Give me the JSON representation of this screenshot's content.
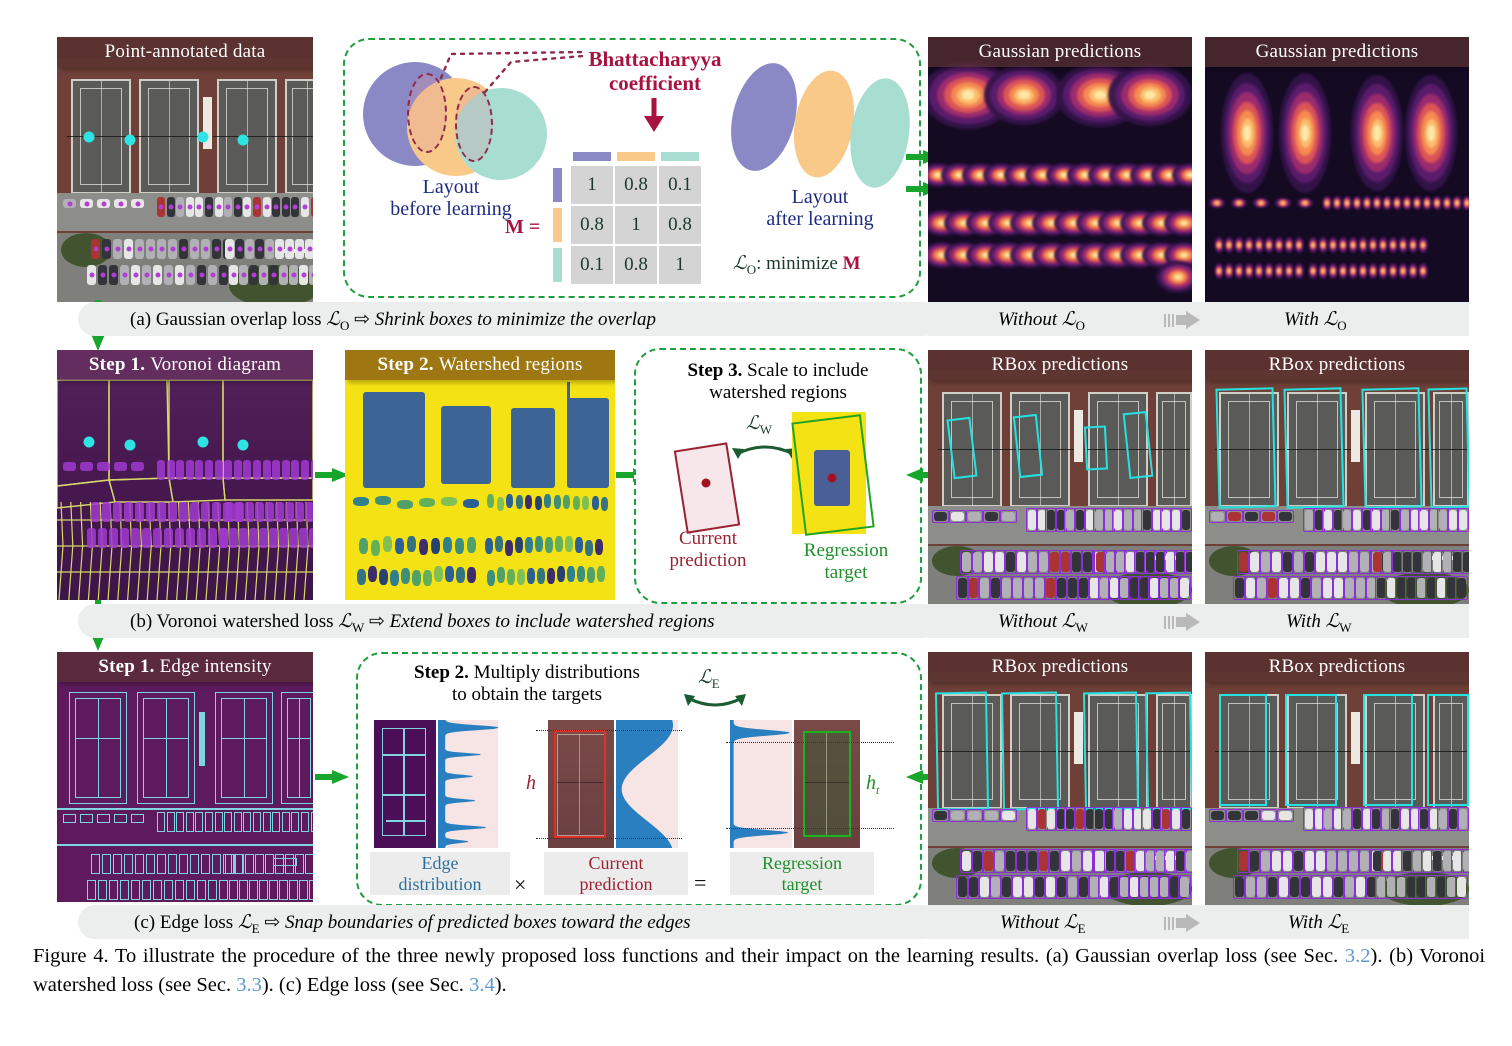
{
  "figure": {
    "caption_prefix": "Figure 4.",
    "caption_body": " To illustrate the procedure of the three newly proposed loss functions and their impact on the learning results. (a) Gaussian overlap loss (see Sec. ",
    "sec_a": "3.2",
    "caption_mid1": "). (b) Voronoi watershed loss (see Sec. ",
    "sec_b": "3.3",
    "caption_mid2": "). (c) Edge loss (see Sec. ",
    "sec_c": "3.4",
    "caption_end": ")."
  },
  "row_a": {
    "input_panel": {
      "title": "Point-annotated data"
    },
    "diagram": {
      "bhattacharyya_title": "Bhattacharyya\ncoefficient",
      "bhattacharyya_line1": "Bhattacharyya",
      "bhattacharyya_line2": "coefficient",
      "layout_before_line1": "Layout",
      "layout_before_line2": "before learning",
      "layout_after_line1": "Layout",
      "layout_after_line2": "after learning",
      "matrix_equals": "M =",
      "matrix_values": [
        [
          "1",
          "0.8",
          "0.1"
        ],
        [
          "0.8",
          "1",
          "0.8"
        ],
        [
          "0.1",
          "0.8",
          "1"
        ]
      ],
      "objective": "ℒO: minimize ",
      "objective_symbol": "ℒ",
      "objective_sub": "O",
      "objective_text": ": minimize ",
      "objective_bold": "M",
      "colors": {
        "purple": "#8b88c6",
        "orange": "#f9c98a",
        "teal": "#a8ddd1",
        "accent": "#a8123f",
        "navy": "#1d2b80"
      }
    },
    "result_left": {
      "title": "Gaussian predictions",
      "label": "Without ℒO",
      "label_word": "Without",
      "label_sym": "ℒ",
      "label_sub": "O"
    },
    "result_right": {
      "title": "Gaussian predictions",
      "label": "With ℒO",
      "label_word": "With",
      "label_sym": "ℒ",
      "label_sub": "O"
    },
    "caption": "(a) Gaussian overlap loss ℒO ⇨ Shrink boxes to minimize the overlap",
    "caption_plain": "(a) Gaussian overlap loss ",
    "caption_sym": "ℒ",
    "caption_sub": "O",
    "caption_arrow": " ⇨ ",
    "caption_italic": "Shrink boxes to minimize the overlap"
  },
  "row_b": {
    "step1": {
      "step": "Step 1.",
      "title": "Voronoi diagram"
    },
    "step2": {
      "step": "Step 2.",
      "title": "Watershed regions"
    },
    "step3": {
      "step": "Step 3.",
      "title_line1": "Scale to include",
      "title_line2": "watershed regions",
      "loss_sym": "ℒ",
      "loss_sub": "W",
      "current_line1": "Current",
      "current_line2": "prediction",
      "target_line1": "Regression",
      "target_line2": "target"
    },
    "result_left": {
      "title": "RBox predictions",
      "label_word": "Without",
      "label_sym": "ℒ",
      "label_sub": "W"
    },
    "result_right": {
      "title": "RBox predictions",
      "label_word": "With",
      "label_sym": "ℒ",
      "label_sub": "W"
    },
    "caption_plain": "(b) Voronoi watershed loss ",
    "caption_sym": "ℒ",
    "caption_sub": "W",
    "caption_arrow": " ⇨ ",
    "caption_italic": "Extend boxes to include watershed regions"
  },
  "row_c": {
    "step1": {
      "step": "Step 1.",
      "title": "Edge intensity"
    },
    "step2": {
      "step": "Step 2.",
      "title_line1": "Multiply distributions",
      "title_line2": "to obtain the targets",
      "loss_sym": "ℒ",
      "loss_sub": "E",
      "h_label": "h",
      "ht_label": "h",
      "ht_sub": "t",
      "edge_line1": "Edge",
      "edge_line2": "distribution",
      "times": "×",
      "current_line1": "Current",
      "current_line2": "prediction",
      "equals": "=",
      "target_line1": "Regression",
      "target_line2": "target"
    },
    "result_left": {
      "title": "RBox predictions",
      "label_word": "Without",
      "label_sym": "ℒ",
      "label_sub": "E"
    },
    "result_right": {
      "title": "RBox predictions",
      "label_word": "With",
      "label_sym": "ℒ",
      "label_sub": "E"
    },
    "caption_plain": "(c) Edge loss ",
    "caption_sym": "ℒ",
    "caption_sub": "E",
    "caption_arrow": " ⇨ ",
    "caption_italic": "Snap boundaries of  predicted boxes toward the edges"
  },
  "icons": {
    "green_arrow": "green-arrow-icon",
    "gray_chevron": "gray-chevron-arrow-icon",
    "red_down_arrow": "red-down-arrow-icon"
  }
}
